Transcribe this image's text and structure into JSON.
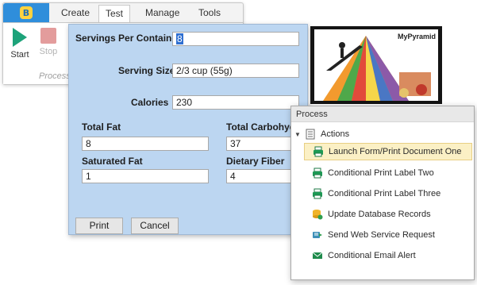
{
  "ribbon": {
    "tabs": [
      "Create",
      "Test",
      "Manage",
      "Tools"
    ],
    "active_tab": "Test",
    "buttons": {
      "start": "Start",
      "stop": "Stop"
    },
    "group_label": "Process"
  },
  "form": {
    "servings_label": "Servings Per Container",
    "servings_value": "8",
    "serving_size_label": "Serving Size",
    "serving_size_value": "2/3 cup (55g)",
    "calories_label": "Calories",
    "calories_value": "230",
    "total_fat_label": "Total Fat",
    "total_fat_value": "8",
    "total_carbs_label": "Total Carbohydr",
    "total_carbs_value": "37",
    "saturated_fat_label": "Saturated Fat",
    "saturated_fat_value": "1",
    "dietary_fiber_label": "Dietary Fiber",
    "dietary_fiber_value": "4",
    "print_button": "Print",
    "cancel_button": "Cancel",
    "image_text": "MyPyramid"
  },
  "process_panel": {
    "title": "Process",
    "root_label": "Actions",
    "items": [
      {
        "label": "Launch Form/Print Document One",
        "icon": "printer-icon",
        "selected": true
      },
      {
        "label": "Conditional Print Label Two",
        "icon": "printer-icon",
        "selected": false
      },
      {
        "label": "Conditional Print Label Three",
        "icon": "printer-icon",
        "selected": false
      },
      {
        "label": "Update Database Records",
        "icon": "database-update-icon",
        "selected": false
      },
      {
        "label": "Send Web Service Request",
        "icon": "web-service-icon",
        "selected": false
      },
      {
        "label": "Conditional Email Alert",
        "icon": "email-icon",
        "selected": false
      }
    ]
  },
  "colors": {
    "accent": "#2f8edb",
    "form_background": "#bcd6f1",
    "start_green": "#1da37a",
    "selection": "#fbf0c5"
  }
}
